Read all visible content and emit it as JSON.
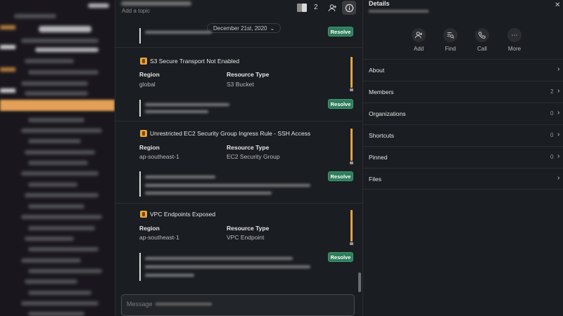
{
  "channel": {
    "topic_placeholder": "Add a topic",
    "member_count": "2",
    "date_divider": "December 21st, 2020",
    "resolve_label": "Resolve",
    "composer_placeholder": "Message",
    "region_label": "Region",
    "resource_type_label": "Resource Type",
    "alerts": [
      {
        "title": "S3 Secure Transport Not Enabled",
        "region": "global",
        "resource_type": "S3 Bucket"
      },
      {
        "title": "Unrestricted EC2 Security Group Ingress Rule - SSH Access",
        "region": "ap-southeast-1",
        "resource_type": "EC2 Security Group"
      },
      {
        "title": "VPC Endpoints Exposed",
        "region": "ap-southeast-1",
        "resource_type": "VPC Endpoint"
      }
    ]
  },
  "details": {
    "title": "Details",
    "actions": [
      {
        "label": "Add",
        "icon": "add-person-icon"
      },
      {
        "label": "Find",
        "icon": "find-icon"
      },
      {
        "label": "Call",
        "icon": "phone-icon"
      },
      {
        "label": "More",
        "icon": "more-icon"
      }
    ],
    "sections": [
      {
        "label": "About",
        "count": ""
      },
      {
        "label": "Members",
        "count": "2"
      },
      {
        "label": "Organizations",
        "count": "0"
      },
      {
        "label": "Shortcuts",
        "count": "0"
      },
      {
        "label": "Pinned",
        "count": "0"
      },
      {
        "label": "Files",
        "count": ""
      }
    ]
  },
  "colors": {
    "resolve_button": "#2f7d5b",
    "alert_accent": "#e8a33d",
    "sidebar_highlight": "#e3a056"
  }
}
